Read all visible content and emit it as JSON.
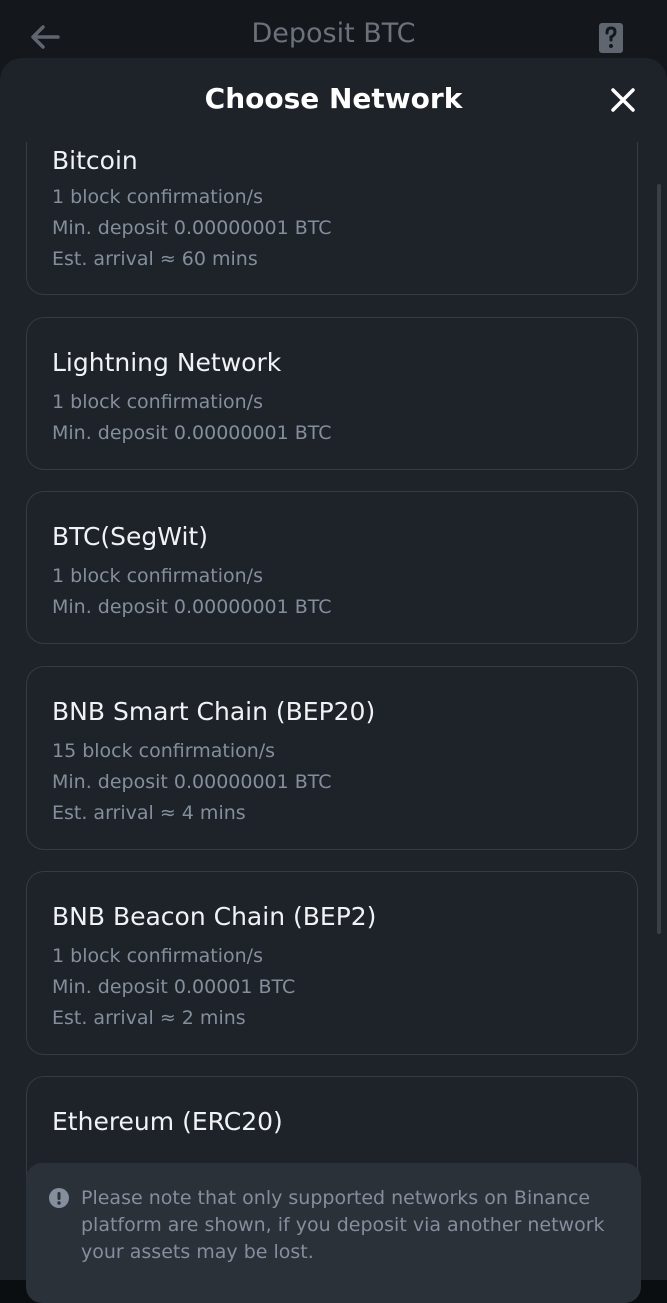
{
  "header": {
    "title": "Deposit BTC",
    "back_icon": "arrow-left-icon",
    "help_icon": "help-document-icon"
  },
  "sheet": {
    "title": "Choose Network",
    "close_icon": "close-icon"
  },
  "networks": [
    {
      "name": "Bitcoin",
      "lines": [
        "1 block confirmation/s",
        "Min. deposit 0.00000001 BTC",
        "Est. arrival ≈ 60 mins"
      ]
    },
    {
      "name": "Lightning Network",
      "lines": [
        "1 block confirmation/s",
        "Min. deposit 0.00000001 BTC"
      ]
    },
    {
      "name": "BTC(SegWit)",
      "lines": [
        "1 block confirmation/s",
        "Min. deposit 0.00000001 BTC"
      ]
    },
    {
      "name": "BNB Smart Chain (BEP20)",
      "lines": [
        "15 block confirmation/s",
        "Min. deposit 0.00000001 BTC",
        "Est. arrival ≈ 4 mins"
      ]
    },
    {
      "name": "BNB Beacon Chain (BEP2)",
      "lines": [
        "1 block confirmation/s",
        "Min. deposit 0.00001 BTC",
        "Est. arrival ≈ 2 mins"
      ]
    },
    {
      "name": "Ethereum (ERC20)",
      "lines": []
    }
  ],
  "notice": {
    "icon": "info-icon",
    "text": "Please note that only supported networks on Binance platform are shown, if you deposit via another network your assets may be lost."
  },
  "colors": {
    "background": "#0b0e11",
    "sheet": "#1e2329",
    "card_border": "#363b42",
    "secondary_text": "#848e9c",
    "notice_bg": "#2b3139"
  }
}
